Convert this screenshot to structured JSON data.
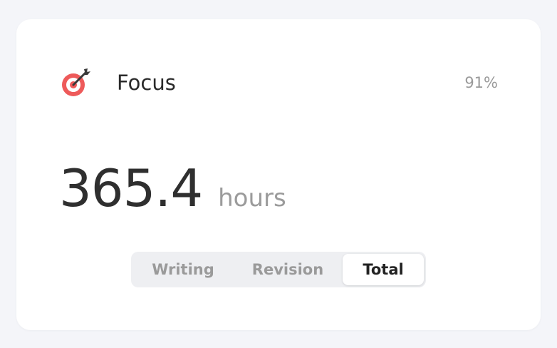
{
  "card": {
    "icon": "dartboard-target-icon",
    "title": "Focus",
    "percent": "91%",
    "value": "365.4",
    "unit": "hours",
    "segments": [
      {
        "label": "Writing",
        "selected": false
      },
      {
        "label": "Revision",
        "selected": false
      },
      {
        "label": "Total",
        "selected": true
      }
    ]
  },
  "colors": {
    "target_red": "#ee5a5a",
    "selected_text": "#222222",
    "muted_text": "#9a9a9a"
  }
}
